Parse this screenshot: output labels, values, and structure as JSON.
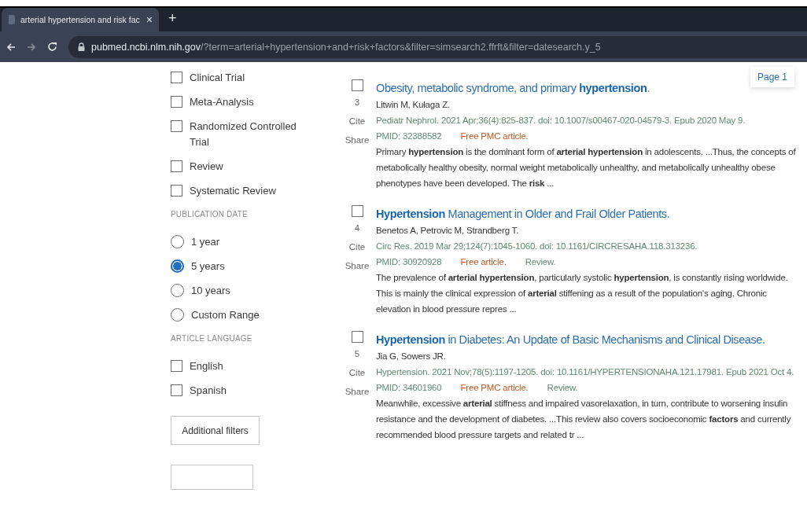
{
  "browser": {
    "tab": {
      "title": "arterial hypertension and risk fac",
      "close": "×"
    },
    "new_tab": "+",
    "url": {
      "host": "pubmed.ncbi.nlm.nih.gov",
      "path": "/?term=arterial+hypertension+and+risk+factors&filter=simsearch2.ffrft&filter=datesearch.y_5"
    }
  },
  "sidebar": {
    "article_types": [
      {
        "label": "Clinical Trial",
        "checked": false
      },
      {
        "label": "Meta-Analysis",
        "checked": false
      },
      {
        "label": "Randomized Controlled Trial",
        "checked": false
      },
      {
        "label": "Review",
        "checked": false
      },
      {
        "label": "Systematic Review",
        "checked": false
      }
    ],
    "publication_date": {
      "heading": "PUBLICATION DATE",
      "options": [
        {
          "label": "1 year",
          "selected": false
        },
        {
          "label": "5 years",
          "selected": true
        },
        {
          "label": "10 years",
          "selected": false
        },
        {
          "label": "Custom Range",
          "selected": false
        }
      ]
    },
    "article_language": {
      "heading": "ARTICLE LANGUAGE",
      "items": [
        {
          "label": "English",
          "checked": false
        },
        {
          "label": "Spanish",
          "checked": false
        }
      ]
    },
    "additional_filters_button": "Additional filters"
  },
  "page_label": "Page 1",
  "results": [
    {
      "number": "3",
      "cite": "Cite",
      "share": "Share",
      "checked": false,
      "title": "Obesity, metabolic syndrome, and primary **hypertension**.",
      "authors": "Litwin M, Kułaga Z.",
      "citation": "Pediatr Nephrol. 2021 Apr;36(4):825-837. doi: 10.1007/s00467-020-04579-3. Epub 2020 May 9.",
      "pmid": "PMID: 32388582",
      "free": "Free PMC article.",
      "snippet": "Primary **hypertension** is the dominant form of **arterial hypertension** in adolescents. ...Thus, the concepts of metabolically healthy obesity, normal weight metabolically unhealthy, and metabolically unhealthy obese phenotypes have been developed. The **risk** ..."
    },
    {
      "number": "4",
      "cite": "Cite",
      "share": "Share",
      "checked": false,
      "title": "**Hypertension** Management in Older and Frail Older Patients.",
      "authors": "Benetos A, Petrovic M, Strandberg T.",
      "citation": "Circ Res. 2019 Mar 29;124(7):1045-1060. doi: 10.1161/CIRCRESAHA.118.313236.",
      "pmid": "PMID: 30920928",
      "free": "Free article.",
      "type": "Review.",
      "snippet": "The prevalence of **arterial hypertension**, particularly systolic **hypertension**, is constantly rising worldwide. This is mainly the clinical expression of **arterial** stiffening as a result of the population's aging. Chronic elevation in blood pressure repres ..."
    },
    {
      "number": "5",
      "cite": "Cite",
      "share": "Share",
      "checked": false,
      "title": "**Hypertension** in Diabetes: An Update of Basic Mechanisms and Clinical Disease.",
      "authors": "Jia G, Sowers JR.",
      "citation": "Hypertension. 2021 Nov;78(5):1197-1205. doi: 10.1161/HYPERTENSIONAHA.121.17981. Epub 2021 Oct 4.",
      "pmid": "PMID: 34601960",
      "free": "Free PMC article.",
      "type": "Review.",
      "snippet": "Meanwhile, excessive **arterial** stiffness and impaired vasorelaxation, in turn, contribute to worsening insulin resistance and the development of diabetes. ...This review also covers socioeconomic **factors** and currently recommended blood pressure targets and related tr ..."
    }
  ]
}
